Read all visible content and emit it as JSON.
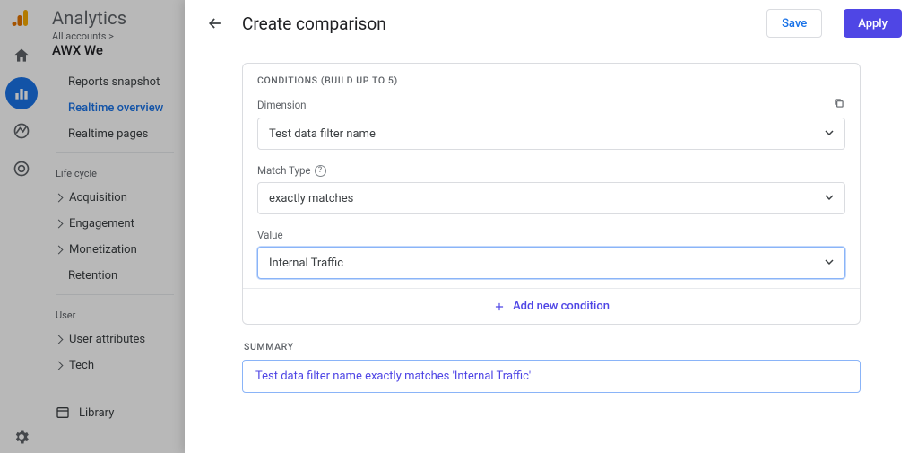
{
  "header": {
    "product": "Analytics",
    "breadcrumb": "All accounts >",
    "property": "AWX We"
  },
  "nav": {
    "reports_snapshot": "Reports snapshot",
    "realtime_overview": "Realtime overview",
    "realtime_pages": "Realtime pages",
    "section_lifecycle": "Life cycle",
    "acquisition": "Acquisition",
    "engagement": "Engagement",
    "monetization": "Monetization",
    "retention": "Retention",
    "section_user": "User",
    "user_attributes": "User attributes",
    "tech": "Tech",
    "library": "Library"
  },
  "panel": {
    "title": "Create comparison",
    "save": "Save",
    "apply": "Apply",
    "conditions_header": "CONDITIONS (BUILD UP TO 5)",
    "dimension_label": "Dimension",
    "dimension_value": "Test data filter name",
    "matchtype_label": "Match Type",
    "matchtype_value": "exactly matches",
    "value_label": "Value",
    "value_value": "Internal Traffic",
    "add_condition": "Add new condition",
    "summary_label": "SUMMARY",
    "summary_text": "Test data filter name exactly matches 'Internal Traffic'"
  }
}
